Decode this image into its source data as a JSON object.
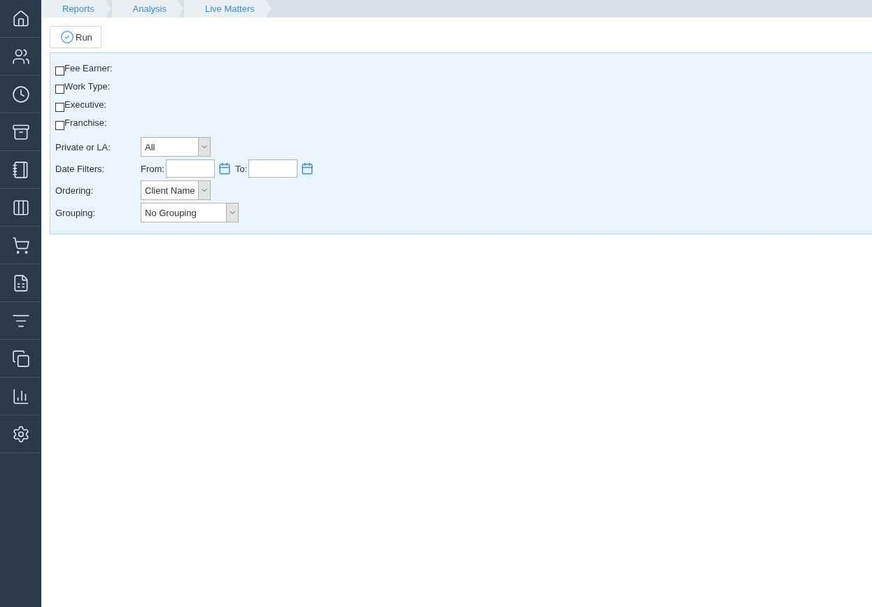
{
  "breadcrumbs": [
    "Reports",
    "Analysis",
    "Live Matters"
  ],
  "toolbar": {
    "run_button": "Run"
  },
  "filters": [
    {
      "kind": "checkbox",
      "label": "Fee Earner:",
      "checked": false
    },
    {
      "kind": "checkbox",
      "label": "Work Type:",
      "checked": false
    },
    {
      "kind": "checkbox",
      "label": "Executive:",
      "checked": false
    },
    {
      "kind": "checkbox",
      "label": "Franchise:",
      "checked": false
    },
    {
      "kind": "select",
      "label": "Private or LA:",
      "value": "All",
      "wide": false
    },
    {
      "kind": "dates",
      "label": "Date Filters:",
      "from_label": "From:",
      "to_label": "To:"
    },
    {
      "kind": "select",
      "label": "Ordering:",
      "value": "Client Name",
      "wide": false
    },
    {
      "kind": "select",
      "label": "Grouping:",
      "value": "No Grouping",
      "wide": true
    }
  ]
}
